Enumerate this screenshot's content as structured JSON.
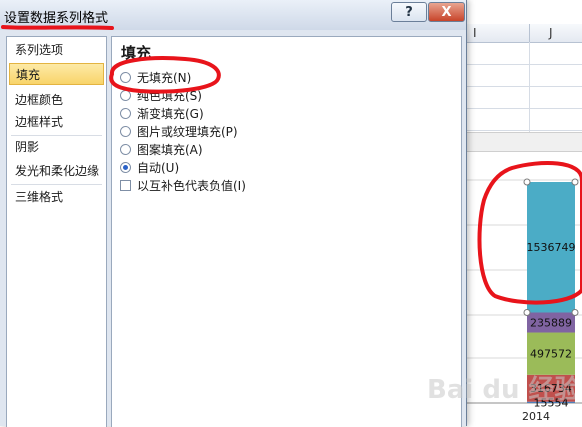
{
  "dialog": {
    "title": "设置数据系列格式",
    "help_label": "?",
    "close_label": "X",
    "nav": [
      {
        "label": "系列选项",
        "selected": false
      },
      {
        "label": "填充",
        "selected": true
      },
      {
        "label": "边框颜色",
        "selected": false
      },
      {
        "label": "边框样式",
        "selected": false
      },
      {
        "label": "阴影",
        "selected": false
      },
      {
        "label": "发光和柔化边缘",
        "selected": false
      },
      {
        "label": "三维格式",
        "selected": false
      }
    ],
    "section_title": "填充",
    "options": [
      {
        "label": "无填充(N)",
        "kind": "radio",
        "checked": false
      },
      {
        "label": "纯色填充(S)",
        "kind": "radio",
        "checked": false
      },
      {
        "label": "渐变填充(G)",
        "kind": "radio",
        "checked": false
      },
      {
        "label": "图片或纹理填充(P)",
        "kind": "radio",
        "checked": false
      },
      {
        "label": "图案填充(A)",
        "kind": "radio",
        "checked": false
      },
      {
        "label": "自动(U)",
        "kind": "radio",
        "checked": true
      },
      {
        "label": "以互补色代表负值(I)",
        "kind": "checkbox",
        "checked": false
      }
    ]
  },
  "sheet": {
    "columns": [
      "I",
      "J"
    ]
  },
  "chart_data": {
    "type": "bar",
    "categories": [
      "2014"
    ],
    "series": [
      {
        "values": [
          15554
        ],
        "color": "#4f81bd"
      },
      {
        "values": [
          316734
        ],
        "color": "#c0504d"
      },
      {
        "values": [
          497572
        ],
        "color": "#9bbb59"
      },
      {
        "values": [
          235889
        ],
        "color": "#8064a2"
      },
      {
        "values": [
          1536749
        ],
        "color": "#4bacc6"
      }
    ],
    "stacked": true,
    "grid": true
  },
  "watermark": {
    "text": "Bai du 经验"
  },
  "colors": {
    "annotation": "#e8141b",
    "selected_nav": "#f8d46a"
  }
}
